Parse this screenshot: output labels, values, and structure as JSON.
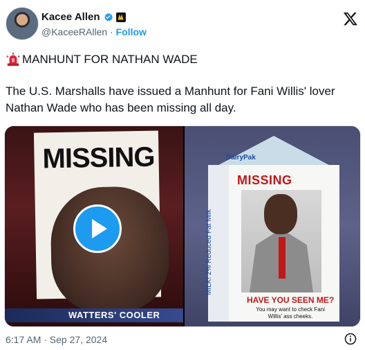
{
  "author": {
    "name": "Kacee Allen",
    "handle": "@KaceeRAllen",
    "separator": "·",
    "follow_label": "Follow"
  },
  "post": {
    "title": "MANHUNT FOR NATHAN WADE",
    "text": "The U.S. Marshalls have issued a Manhunt for Fani Willis' lover Nathan Wade who has been missing all day."
  },
  "media": {
    "left": {
      "sign_text": "MISSING",
      "banner_text": "WATTERS' COOLER"
    },
    "right": {
      "brand": "DairyPak",
      "side_text": "MILK!",
      "side_label": "2% Reduced Fat Milk",
      "missing_text": "MISSING",
      "seen_text": "HAVE YOU SEEN ME?",
      "check_text": "You may want to check Fani Willis' ass cheeks."
    }
  },
  "meta": {
    "timestamp": "6:17 AM · Sep 27, 2024"
  },
  "colors": {
    "accent": "#1d9bf0",
    "muted": "#536471",
    "text": "#0f1419"
  },
  "icons": [
    "verified-icon",
    "affiliate-badge-icon",
    "x-logo-icon",
    "siren-icon",
    "play-icon",
    "info-icon"
  ]
}
